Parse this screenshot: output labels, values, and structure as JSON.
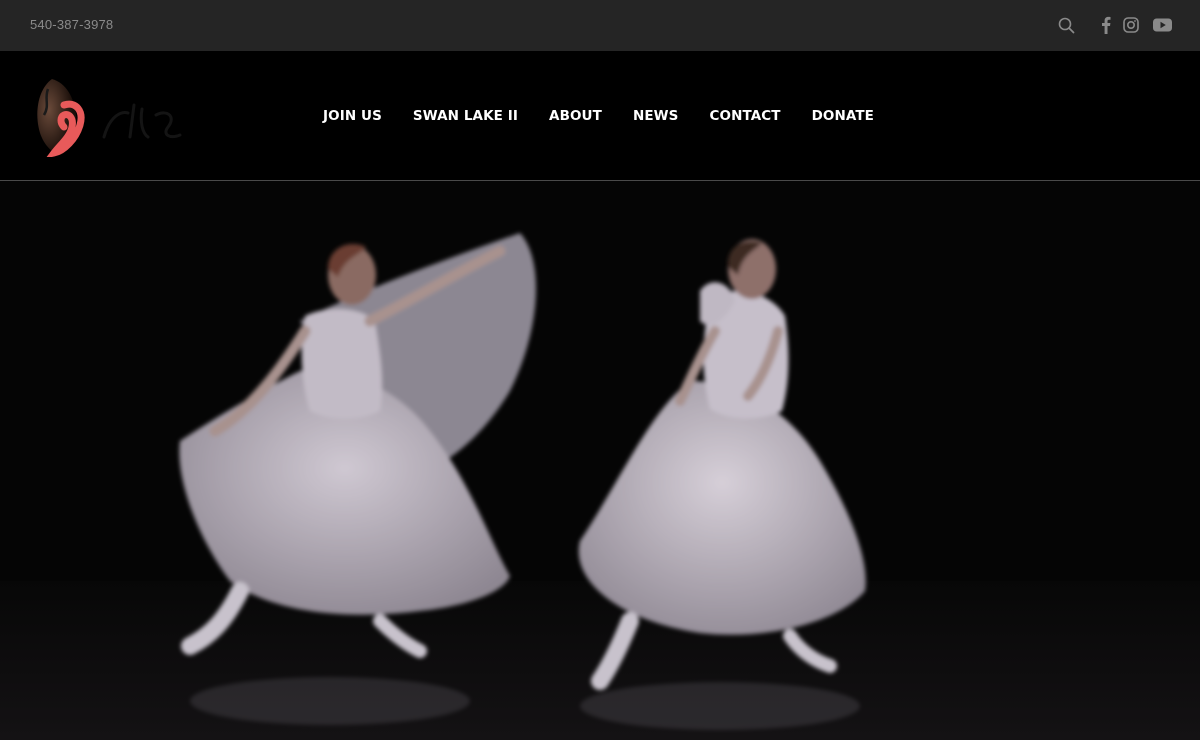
{
  "topbar": {
    "phone": "540-387-3978",
    "icons": [
      "search-icon",
      "facebook-icon",
      "instagram-icon",
      "youtube-icon"
    ],
    "icon_color": "#8a8a8a",
    "background": "#252525"
  },
  "header": {
    "logo_icon": "dance-logo-icon",
    "nav": [
      {
        "label": "JOIN US"
      },
      {
        "label": "SWAN LAKE II"
      },
      {
        "label": "ABOUT"
      },
      {
        "label": "NEWS"
      },
      {
        "label": "CONTACT"
      },
      {
        "label": "DONATE"
      }
    ],
    "background": "#000000",
    "accent": "#e85a5a"
  },
  "hero": {
    "image": "two-ballet-dancers-in-white-feathered-dresses-on-dark-stage"
  }
}
